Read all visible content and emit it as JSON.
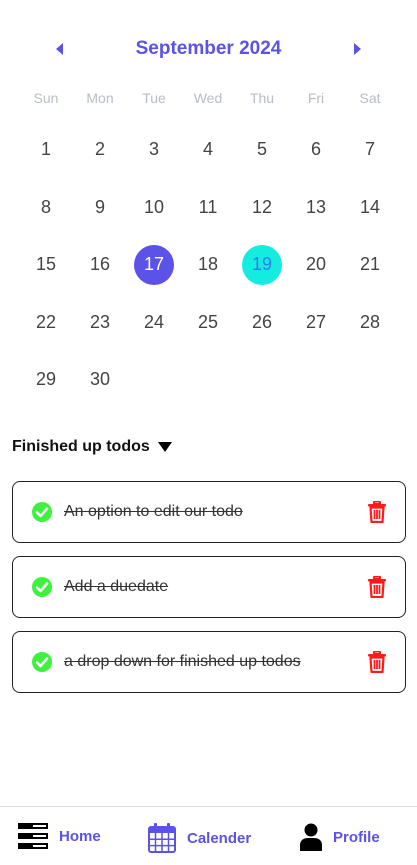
{
  "calendar": {
    "month_title": "September 2024",
    "weekdays": [
      "Sun",
      "Mon",
      "Tue",
      "Wed",
      "Thu",
      "Fri",
      "Sat"
    ],
    "weeks": [
      [
        "1",
        "2",
        "3",
        "4",
        "5",
        "6",
        "7"
      ],
      [
        "8",
        "9",
        "10",
        "11",
        "12",
        "13",
        "14"
      ],
      [
        "15",
        "16",
        "17",
        "18",
        "19",
        "20",
        "21"
      ],
      [
        "22",
        "23",
        "24",
        "25",
        "26",
        "27",
        "28"
      ],
      [
        "29",
        "30",
        "",
        "",
        "",
        "",
        ""
      ]
    ],
    "selected_day": "17",
    "today": "19",
    "colors": {
      "accent": "#5b52e8",
      "today": "#14ece0",
      "today_text": "#2c7df0"
    }
  },
  "finished_section": {
    "title": "Finished up todos",
    "todos": [
      {
        "text": "An option to edit our todo"
      },
      {
        "text": "Add a duedate"
      },
      {
        "text": "a drop down for finished up todos"
      }
    ],
    "icons": {
      "check": "check-circle-icon",
      "delete": "trash-icon"
    },
    "colors": {
      "check": "#3cf23c",
      "delete": "#ff1a1a"
    }
  },
  "bottom_nav": {
    "items": [
      {
        "label": "Home",
        "icon": "home-menu-icon"
      },
      {
        "label": "Calender",
        "icon": "calendar-icon"
      },
      {
        "label": "Profile",
        "icon": "user-icon"
      }
    ]
  }
}
